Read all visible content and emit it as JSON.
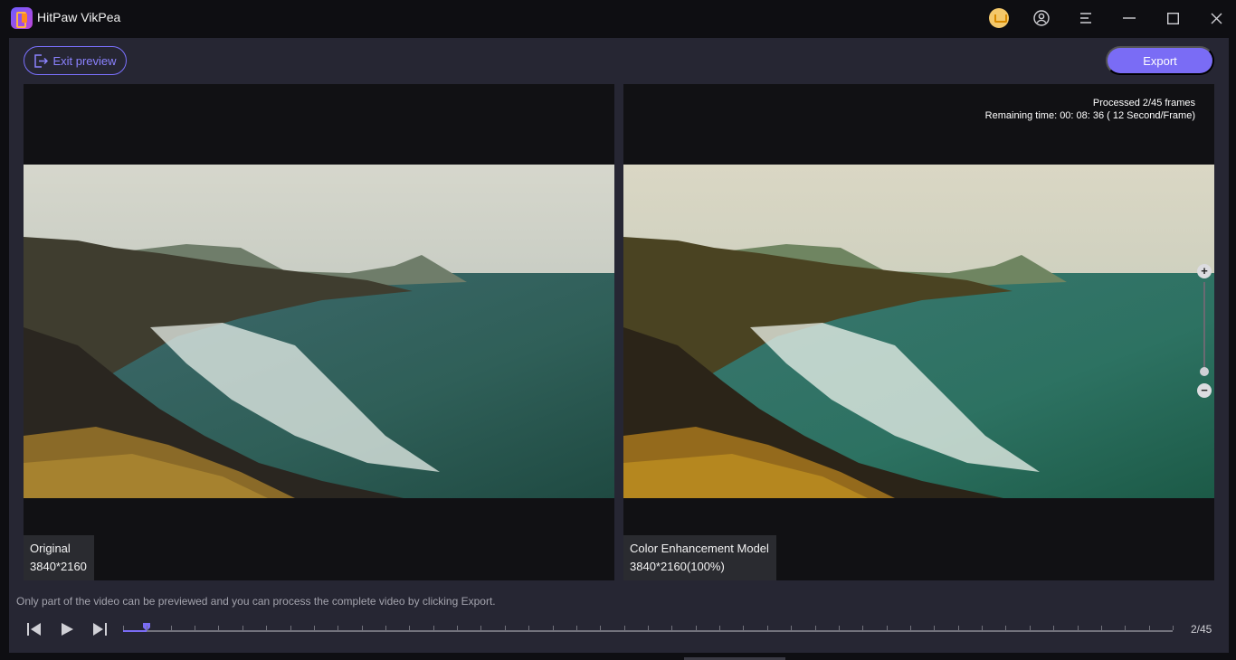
{
  "app": {
    "title": "HitPaw VikPea"
  },
  "toolbar": {
    "exit_label": "Exit preview",
    "export_label": "Export"
  },
  "left_pane": {
    "title": "Original",
    "resolution": "3840*2160"
  },
  "right_pane": {
    "title": "Color Enhancement Model",
    "resolution": "3840*2160(100%)",
    "processed": "Processed 2/45 frames",
    "remaining": "Remaining time: 00: 08: 36 ( 12 Second/Frame)"
  },
  "footer": {
    "hint": "Only part of the video can be previewed and you can process the complete video by clicking Export.",
    "frame_counter": "2/45"
  },
  "timeline": {
    "current_frame": 2,
    "total_frames": 45,
    "progress_fraction": 0.022
  },
  "colors": {
    "accent": "#7a6cf5",
    "background": "#262633",
    "pane": "#111114"
  }
}
